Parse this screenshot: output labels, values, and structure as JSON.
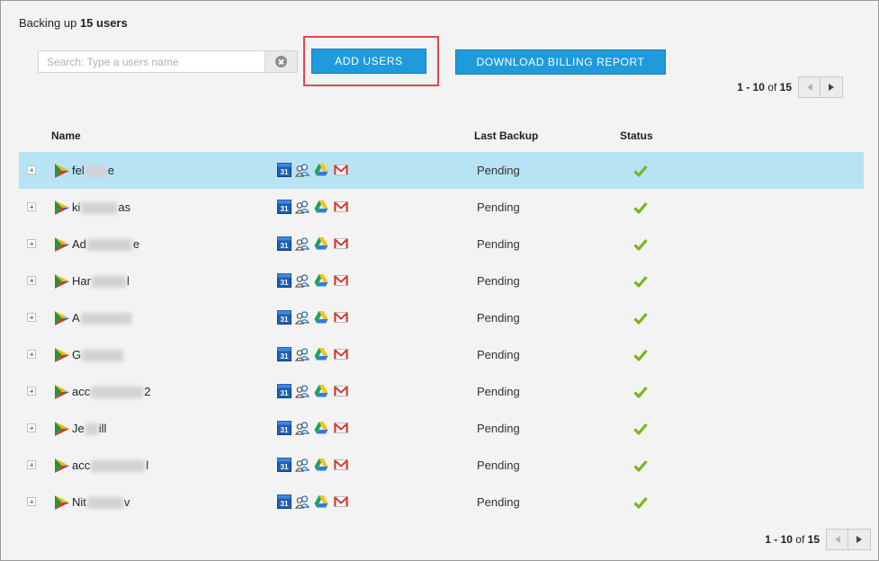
{
  "header": {
    "prefix": "Backing up",
    "count_label": "15 users"
  },
  "search": {
    "placeholder": "Search: Type a users name",
    "value": ""
  },
  "buttons": {
    "add_users": "ADD USERS",
    "download_billing": "DOWNLOAD BILLING REPORT"
  },
  "pagination": {
    "range": "1 - 10",
    "of_label": "of",
    "total": "15"
  },
  "table": {
    "columns": {
      "name": "Name",
      "last_backup": "Last Backup",
      "status": "Status"
    },
    "rows": [
      {
        "name_start": "fel",
        "name_end": "e",
        "last_backup": "Pending",
        "status": "ok",
        "selected": true
      },
      {
        "name_start": "ki",
        "name_end": "as",
        "last_backup": "Pending",
        "status": "ok",
        "selected": false
      },
      {
        "name_start": "Ad",
        "name_end": "e",
        "last_backup": "Pending",
        "status": "ok",
        "selected": false
      },
      {
        "name_start": "Har",
        "name_end": "l",
        "last_backup": "Pending",
        "status": "ok",
        "selected": false
      },
      {
        "name_start": "A",
        "name_end": "",
        "last_backup": "Pending",
        "status": "ok",
        "selected": false
      },
      {
        "name_start": "G",
        "name_end": "",
        "last_backup": "Pending",
        "status": "ok",
        "selected": false
      },
      {
        "name_start": "acc",
        "name_end": "2",
        "last_backup": "Pending",
        "status": "ok",
        "selected": false
      },
      {
        "name_start": "Je",
        "name_end": "ill",
        "last_backup": "Pending",
        "status": "ok",
        "selected": false
      },
      {
        "name_start": "acc",
        "name_end": "l",
        "last_backup": "Pending",
        "status": "ok",
        "selected": false
      },
      {
        "name_start": "Nit",
        "name_end": "v",
        "last_backup": "Pending",
        "status": "ok",
        "selected": false
      }
    ]
  },
  "services": {
    "calendar_day": "31",
    "icons": [
      "calendar-icon",
      "contacts-icon",
      "drive-icon",
      "gmail-icon"
    ]
  },
  "colors": {
    "accent_button": "#1f9bdc",
    "selected_row": "#b8e3f5",
    "highlight_border": "#e0474f",
    "check_green": "#7ab51d"
  }
}
